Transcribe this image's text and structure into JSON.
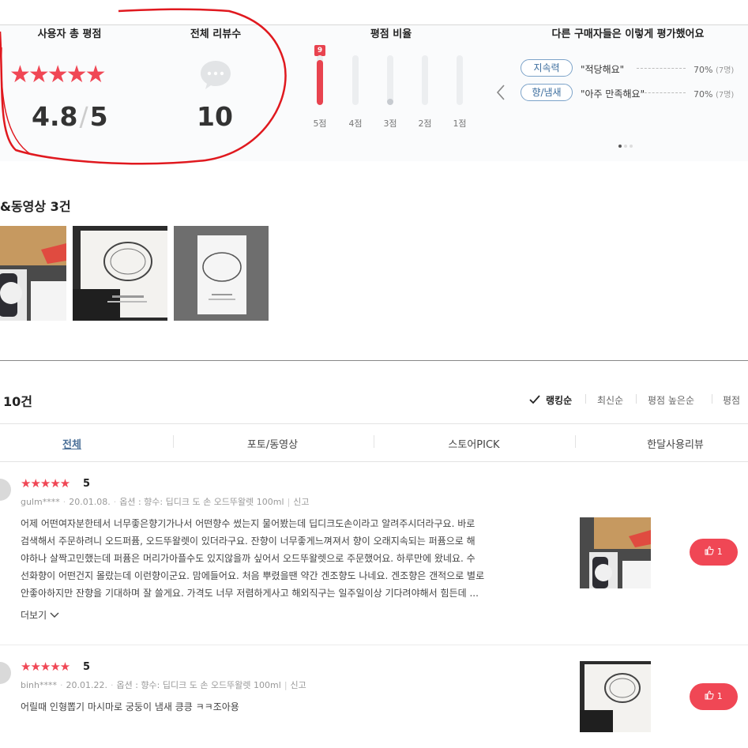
{
  "summary": {
    "avg_title": "사용자 총 평점",
    "total_title": "전체 리뷰수",
    "ratio_title": "평점 비율",
    "others_title": "다른 구매자들은 이렇게 평가했어요",
    "avg_score": "4.8",
    "max_score": "5",
    "stars": "★★★★★",
    "review_total": "10",
    "bars": [
      {
        "label": "5점",
        "fraction": 0.9,
        "badge": "9"
      },
      {
        "label": "4점",
        "fraction": 0.0
      },
      {
        "label": "3점",
        "fraction": 0.1
      },
      {
        "label": "2점",
        "fraction": 0.0
      },
      {
        "label": "1점",
        "fraction": 0.0
      }
    ],
    "tags": [
      {
        "name": "지속력",
        "quote": "\"적당해요\"",
        "pct": "70%",
        "count": "(7명)"
      },
      {
        "name": "향/냄새",
        "quote": "\"아주 만족해요\"",
        "pct": "70%",
        "count": "(7명)"
      }
    ]
  },
  "photo": {
    "title": "&동영상 3건"
  },
  "reviews_header": {
    "count": "10건",
    "sort": [
      "랭킹순",
      "최신순",
      "평점 높은순",
      "평점"
    ],
    "tabs": [
      "전체",
      "포토/동영상",
      "스토어PICK",
      "한달사용리뷰"
    ]
  },
  "reviews": [
    {
      "stars": "★★★★★",
      "score": "5",
      "user": "gulm****",
      "date": "20.01.08.",
      "option": "옵션 : 향수: 딥디크 도 손 오드뚜왈렛 100ml",
      "report": "신고",
      "lines": [
        "어제 어떤여자분한테서 너무좋은향기가나서 어떤향수 썼는지 물어봤는데 딥디크도손이라고 알려주시더라구요. 바로",
        "검색해서 주문하려니 오드퍼퓸, 오드뚜왈렛이 있더라구요. 잔향이 너무좋게느껴져서 향이 오래지속되는 퍼퓸으로 해",
        "야하나 살짝고민했는데 퍼퓸은 머리가아플수도 있지않을까 싶어서 오드뚜왈렛으로 주문했어요. 하루만에 왔네요. 수",
        "선화향이 어떤건지 몰랐는데 이런향이군요. 맘에들어요. 처음 뿌렸을땐 약간 겐조향도 나네요. 겐조향은 갠적으로 별로",
        "안좋아하지만 잔향을 기대하며 잘 쓸게요. 가격도 너무 저렴하게사고 해외직구는 일주일이상 기다려야해서 힘든데 ..."
      ],
      "more": "더보기",
      "likes": "1"
    },
    {
      "stars": "★★★★★",
      "score": "5",
      "user": "binh****",
      "date": "20.01.22.",
      "option": "옵션 : 향수: 딥디크 도 손 오드뚜왈렛 100ml",
      "report": "신고",
      "lines": [
        "어릴때 인형뽑기 마시마로 궁둥이 냄새 킁킁 ㅋㅋ조아용"
      ],
      "likes": "1"
    }
  ]
}
